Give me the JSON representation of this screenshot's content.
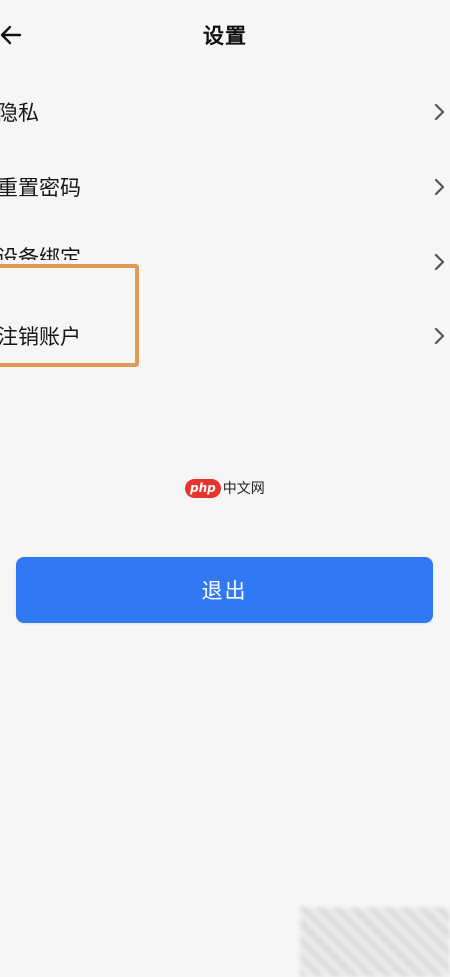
{
  "header": {
    "title": "设置",
    "back_icon": "arrow-left-icon"
  },
  "menu": {
    "items": [
      {
        "label": "隐私",
        "icon": "chevron-right-icon"
      },
      {
        "label": "重置密码",
        "icon": "chevron-right-icon"
      },
      {
        "label": "设备绑定",
        "icon": "chevron-right-icon"
      },
      {
        "label": "注销账户",
        "icon": "chevron-right-icon"
      }
    ]
  },
  "watermark": {
    "logo": "php",
    "text": "中文网"
  },
  "logout": {
    "label": "退出"
  },
  "colors": {
    "background": "#f6f6f6",
    "button": "#3179f3",
    "highlight": "#e09a55",
    "watermark_logo": "#e8342d"
  }
}
